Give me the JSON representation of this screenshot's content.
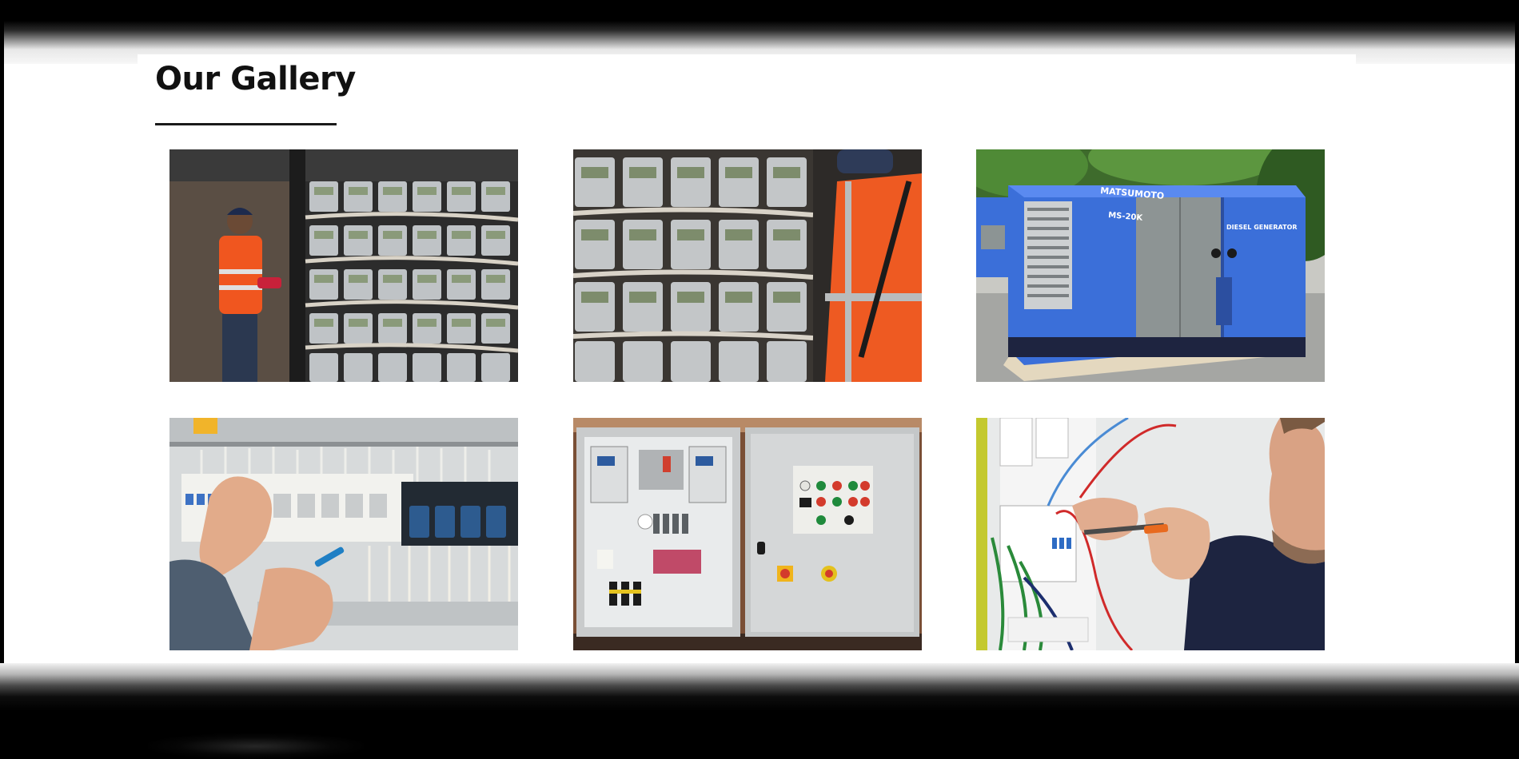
{
  "gallery": {
    "title": "Our Gallery",
    "photos": [
      {
        "subject": "Technician in orange safety vest inspecting a wall of electricity meters"
      },
      {
        "subject": "Rows of electricity meters with a worker in an orange vest"
      },
      {
        "subject": "Blue Matsumoto MS-20K diesel generator",
        "printed_text": [
          "MATSUMOTO",
          "MS-20K",
          "DIESEL GENERATOR"
        ]
      },
      {
        "subject": "Hands wiring an electrical distribution board"
      },
      {
        "subject": "Open electrical control panel next to a closed control panel with indicator lights"
      },
      {
        "subject": "Electrician with screwdriver working on a circuit breaker box"
      }
    ]
  },
  "colors": {
    "title": "#111111",
    "generator_blue": "#3b6fd9",
    "vest_orange": "#f0561f"
  }
}
